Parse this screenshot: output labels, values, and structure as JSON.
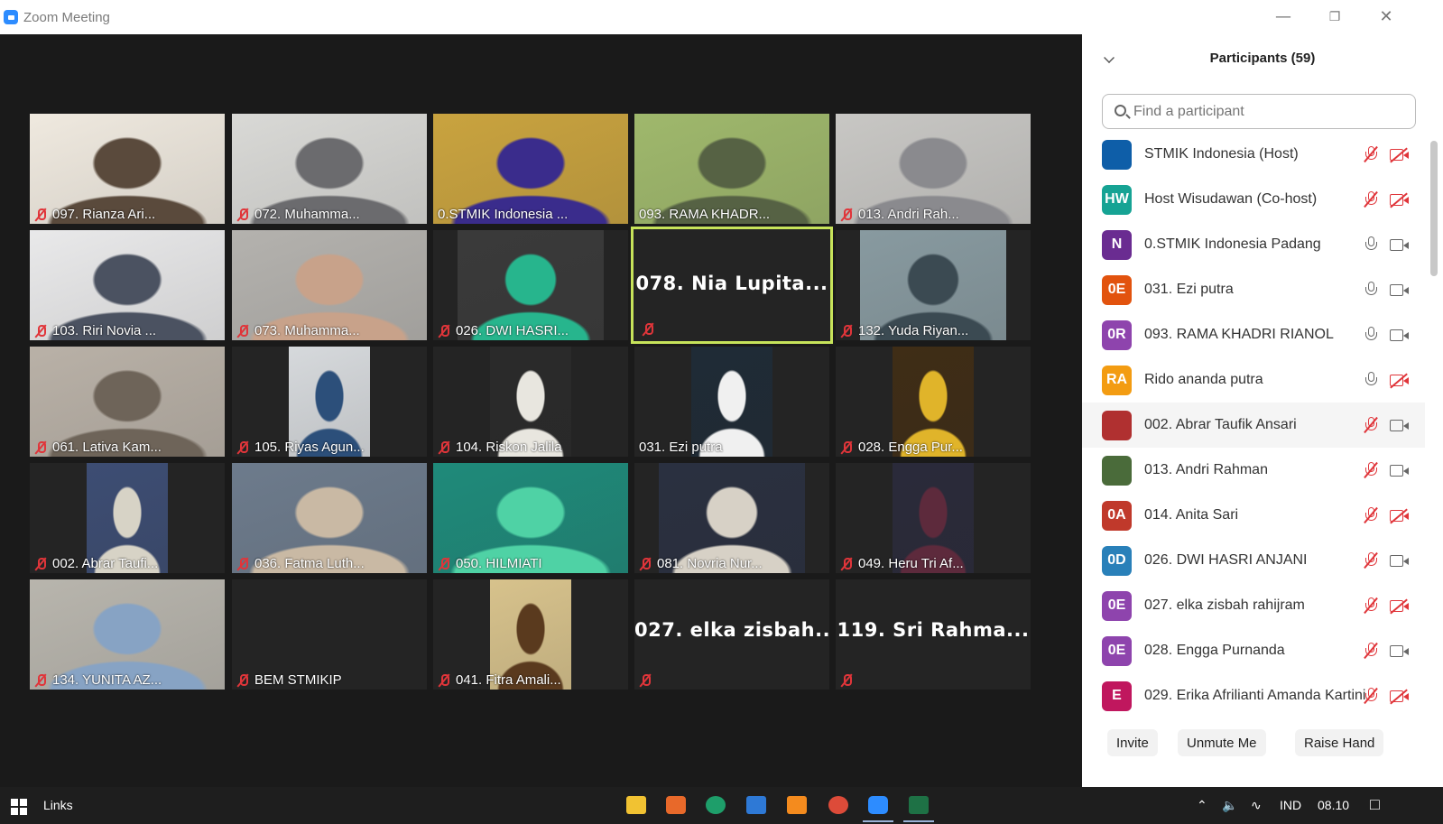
{
  "window": {
    "title": "Zoom Meeting"
  },
  "tiles": [
    {
      "name": "097. Rianza Ari...",
      "muted": true
    },
    {
      "name": "072. Muhamma...",
      "muted": true
    },
    {
      "name": "0.STMIK Indonesia ...",
      "muted": false
    },
    {
      "name": "093. RAMA KHADR...",
      "muted": false
    },
    {
      "name": "013. Andri Rah...",
      "muted": true
    },
    {
      "name": "103. Riri Novia ...",
      "muted": true
    },
    {
      "name": "073. Muhamma...",
      "muted": true
    },
    {
      "name": "026. DWI HASRI...",
      "muted": true
    },
    {
      "name": "078. Nia Lupita...",
      "muted": true,
      "video_off": true,
      "active": true
    },
    {
      "name": "132. Yuda Riyan...",
      "muted": true
    },
    {
      "name": "061. Lativa Kam...",
      "muted": true
    },
    {
      "name": "105. Riyas Agun...",
      "muted": true
    },
    {
      "name": "104. Riskon Jalila",
      "muted": true
    },
    {
      "name": "031. Ezi putra",
      "muted": false
    },
    {
      "name": "028. Engga Pur...",
      "muted": true
    },
    {
      "name": "002. Abrar Taufi...",
      "muted": true
    },
    {
      "name": "036. Fatma Luth...",
      "muted": true
    },
    {
      "name": "050. HILMIATI",
      "muted": true
    },
    {
      "name": "081. Novria Nur...",
      "muted": true
    },
    {
      "name": "049. Heru Tri Af...",
      "muted": true
    },
    {
      "name": "134. YUNITA AZ...",
      "muted": true
    },
    {
      "name": "BEM STMIKIP",
      "muted": true,
      "video_off": true
    },
    {
      "name": "041. Fitra Amali...",
      "muted": true
    },
    {
      "name": "027. elka zisbah...",
      "muted": true,
      "video_off": true
    },
    {
      "name": "119. Sri Rahma...",
      "muted": true,
      "video_off": true
    }
  ],
  "participants_panel": {
    "title": "Participants (59)",
    "search_placeholder": "Find a participant",
    "participants": [
      {
        "initials": "",
        "color": "#0e5ea8",
        "name": "STMIK Indonesia (Host)",
        "mic": "off",
        "cam": "off"
      },
      {
        "initials": "HW",
        "color": "#16a394",
        "name": "Host Wisudawan (Co-host)",
        "mic": "off",
        "cam": "off"
      },
      {
        "initials": "N",
        "color": "#6a2c91",
        "name": "0.STMIK Indonesia Padang",
        "mic": "on",
        "cam": "on"
      },
      {
        "initials": "0E",
        "color": "#e2530e",
        "name": "031. Ezi putra",
        "mic": "on",
        "cam": "on"
      },
      {
        "initials": "0R",
        "color": "#8e44ad",
        "name": "093. RAMA KHADRI RIANOL",
        "mic": "on",
        "cam": "on"
      },
      {
        "initials": "RA",
        "color": "#f39c12",
        "name": "Rido ananda putra",
        "mic": "on",
        "cam": "off"
      },
      {
        "initials": "",
        "color": "#b03030",
        "name": "002. Abrar Taufik Ansari",
        "mic": "off",
        "cam": "on"
      },
      {
        "initials": "",
        "color": "#4a6b3a",
        "name": "013. Andri Rahman",
        "mic": "off",
        "cam": "on"
      },
      {
        "initials": "0A",
        "color": "#c0392b",
        "name": "014. Anita Sari",
        "mic": "off",
        "cam": "off"
      },
      {
        "initials": "0D",
        "color": "#2980b9",
        "name": "026. DWI HASRI ANJANI",
        "mic": "off",
        "cam": "on"
      },
      {
        "initials": "0E",
        "color": "#8e44ad",
        "name": "027. elka zisbah rahijram",
        "mic": "off",
        "cam": "off"
      },
      {
        "initials": "0E",
        "color": "#8e44ad",
        "name": "028. Engga Purnanda",
        "mic": "off",
        "cam": "on"
      },
      {
        "initials": "E",
        "color": "#c0175e",
        "name": "029. Erika Afrilianti Amanda Kartini",
        "mic": "off",
        "cam": "off"
      }
    ],
    "buttons": {
      "invite": "Invite",
      "unmute": "Unmute Me",
      "raise_hand": "Raise Hand"
    }
  },
  "taskbar": {
    "links_label": "Links",
    "language": "IND",
    "time": "08.10"
  }
}
